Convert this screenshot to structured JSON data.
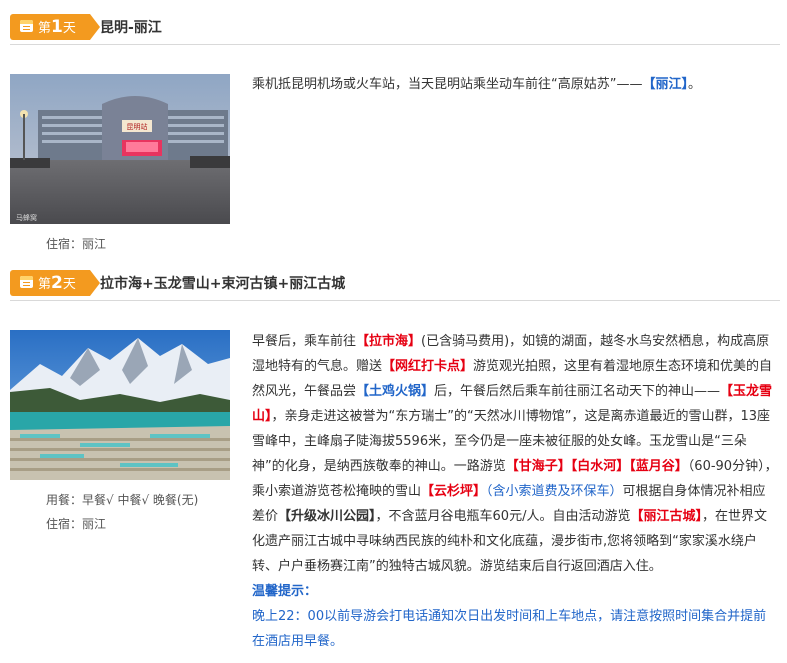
{
  "day1": {
    "badge_prefix": "第",
    "badge_num": "1",
    "badge_suffix": "天",
    "title": "昆明-丽江",
    "desc_main": "乘机抵昆明机场或火车站，当天昆明站乘坐动车前往“高原姑苏”——",
    "desc_link": "【丽江】",
    "desc_end": "。",
    "image": {
      "station_sign": "昆明站",
      "watermark": "马蜂窝"
    },
    "lodging": "住宿：丽江"
  },
  "day2": {
    "badge_prefix": "第",
    "badge_num": "2",
    "badge_suffix": "天",
    "title": "拉市海+玉龙雪山+束河古镇+丽江古城",
    "meal": "用餐：早餐√  中餐√  晚餐(无)",
    "lodging": "住宿：丽江",
    "desc": {
      "t1": "早餐后，乘车前往",
      "h1": "【拉市海】",
      "t2": "(已含骑马费用)，如镜的湖面，越冬水鸟安然栖息，构成高原湿地特有的气息。赠送",
      "h2": "【网红打卡点】",
      "t3": "游览观光拍照，这里有着湿地原生态环境和优美的自然风光，午餐品尝",
      "b1": "【土鸡火锅】",
      "t4": "后，午餐后然后乘车前往丽江名动天下的神山——",
      "h3": "【玉龙雪山】",
      "t5": "，亲身走进这被誉为“东方瑞士”的“天然冰川博物馆”，这是离赤道最近的雪山群，13座雪峰中，主峰扇子陡海拔5596米，至今仍是一座未被征服的处女峰。玉龙雪山是“三朵神”的化身，是纳西族敬奉的神山。一路游览",
      "h4": "【甘海子】",
      "h5": "【白水河】",
      "h6": "【蓝月谷】",
      "t6": "（60-90分钟），乘小索道游览苍松掩映的雪山",
      "h7": "【云杉坪】",
      "blue1": "（含小索道费及环保车）",
      "t7": "可根据自身体情况补相应差价",
      "bold1": "【升级冰川公园】",
      "t8": "，不含蓝月谷电瓶车60元/人。自由活动游览",
      "h8": "【丽江古城】",
      "t9": "，在世界文化遗产丽江古城中寻味纳西民族的纯朴和文化底蕴，漫步街市,您将领略到“家家溪水绕户转、户户垂杨赛江南”的独特古城风貌。游览结束后自行返回酒店入住。"
    },
    "tip_title": "温馨提示：",
    "tip_body": "晚上22：00以前导游会打电话通知次日出发时间和上车地点，请注意按照时间集合并提前在酒店用早餐。"
  },
  "colors": {
    "badge": "#f39a1f",
    "highlight": "#e60012",
    "link": "#2266c9"
  }
}
